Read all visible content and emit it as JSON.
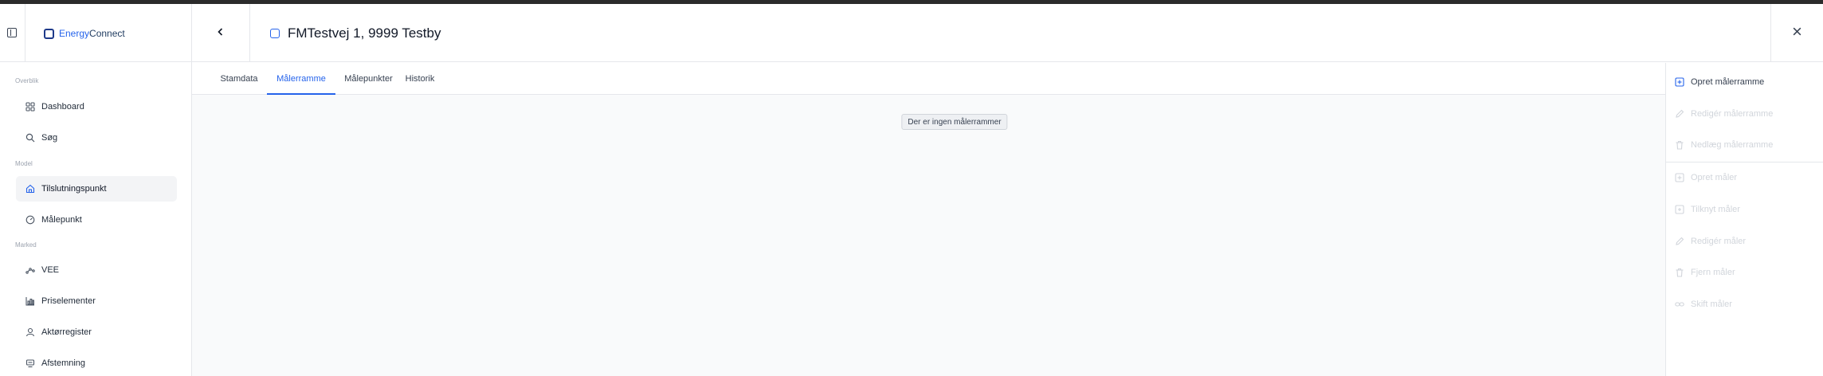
{
  "sidebar": {
    "brand": {
      "part1": "Energy",
      "part2": "Connect"
    },
    "sections": [
      {
        "label": "Overblik"
      },
      {
        "label": "Model"
      },
      {
        "label": "Marked"
      }
    ],
    "items": [
      {
        "label": "Dashboard",
        "icon": "grid-icon"
      },
      {
        "label": "Søg",
        "icon": "search-icon"
      },
      {
        "label": "Tilslutningspunkt",
        "icon": "house-icon"
      },
      {
        "label": "Målepunkt",
        "icon": "gauge-icon"
      },
      {
        "label": "VEE",
        "icon": "share-nodes-icon"
      },
      {
        "label": "Priselementer",
        "icon": "bar-chart-icon"
      },
      {
        "label": "Aktørregister",
        "icon": "user-icon"
      },
      {
        "label": "Afstemning",
        "icon": "scale-icon"
      }
    ]
  },
  "header": {
    "title": "FMTestvej 1, 9999 Testby"
  },
  "tabs": [
    {
      "label": "Stamdata"
    },
    {
      "label": "Målerramme"
    },
    {
      "label": "Målepunkter"
    },
    {
      "label": "Historik"
    }
  ],
  "main": {
    "empty_message": "Der er ingen målerrammer"
  },
  "actions": [
    {
      "label": "Opret målerramme",
      "icon": "plus-square-icon",
      "enabled": true
    },
    {
      "label": "Redigér målerramme",
      "icon": "pencil-icon",
      "enabled": false
    },
    {
      "label": "Nedlæg målerramme",
      "icon": "trash-icon",
      "enabled": false
    },
    {
      "label": "Opret måler",
      "icon": "plus-square-icon",
      "enabled": false
    },
    {
      "label": "Tilknyt måler",
      "icon": "link-square-icon",
      "enabled": false
    },
    {
      "label": "Redigér måler",
      "icon": "pencil-icon",
      "enabled": false
    },
    {
      "label": "Fjern måler",
      "icon": "trash-icon",
      "enabled": false
    },
    {
      "label": "Skift måler",
      "icon": "swap-icon",
      "enabled": false
    }
  ],
  "colors": {
    "accent": "#2563eb",
    "brand_dark": "#1e3a5f",
    "disabled_text": "#d1d5db",
    "active_nav_bg": "#f3f4f6"
  }
}
